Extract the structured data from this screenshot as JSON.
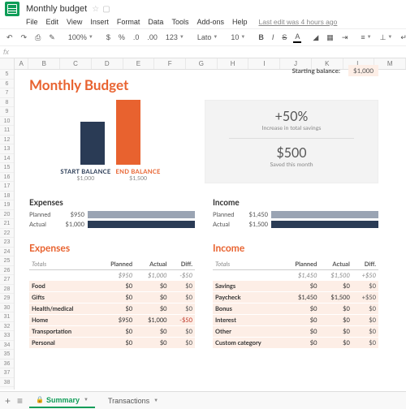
{
  "header": {
    "doc_title": "Monthly budget",
    "last_edit": "Last edit was 4 hours ago"
  },
  "menu": {
    "items": [
      "File",
      "Edit",
      "View",
      "Insert",
      "Format",
      "Data",
      "Tools",
      "Add-ons",
      "Help"
    ]
  },
  "toolbar": {
    "zoom": "100%",
    "currency": "$",
    "percent": "%",
    "decimal": ".0",
    "decimal2": ".00",
    "num_format": "123",
    "font": "Lato",
    "font_size": "10",
    "bold": "B",
    "italic": "I",
    "strike": "S",
    "text_color": "A"
  },
  "doc": {
    "starting_balance_label": "Starting balance:",
    "starting_balance": "$1,000",
    "title": "Monthly Budget",
    "bars": {
      "start": {
        "label": "START BALANCE",
        "value": "$1,000"
      },
      "end": {
        "label": "END BALANCE",
        "value": "$1,500"
      }
    },
    "metrics": {
      "pct": "+50%",
      "pct_sub": "Increase in total savings",
      "saved": "$500",
      "saved_sub": "Saved this month"
    },
    "summary": {
      "expenses": {
        "title": "Expenses",
        "planned_lbl": "Planned",
        "planned": "$950",
        "actual_lbl": "Actual",
        "actual": "$1,000"
      },
      "income": {
        "title": "Income",
        "planned_lbl": "Planned",
        "planned": "$1,450",
        "actual_lbl": "Actual",
        "actual": "$1,500"
      }
    },
    "tables": {
      "expenses": {
        "title": "Expenses",
        "headers": [
          "Totals",
          "Planned",
          "Actual",
          "Diff."
        ],
        "totals": [
          "$950",
          "$1,000",
          "-$50"
        ],
        "rows": [
          {
            "name": "Food",
            "planned": "$0",
            "actual": "$0",
            "diff": "$0"
          },
          {
            "name": "Gifts",
            "planned": "$0",
            "actual": "$0",
            "diff": "$0"
          },
          {
            "name": "Health/medical",
            "planned": "$0",
            "actual": "$0",
            "diff": "$0"
          },
          {
            "name": "Home",
            "planned": "$950",
            "actual": "$1,000",
            "diff": "-$50",
            "neg": true
          },
          {
            "name": "Transportation",
            "planned": "$0",
            "actual": "$0",
            "diff": "$0"
          },
          {
            "name": "Personal",
            "planned": "$0",
            "actual": "$0",
            "diff": "$0"
          }
        ]
      },
      "income": {
        "title": "Income",
        "headers": [
          "Totals",
          "Planned",
          "Actual",
          "Diff."
        ],
        "totals": [
          "$1,450",
          "$1,500",
          "+$50"
        ],
        "rows": [
          {
            "name": "Savings",
            "planned": "$0",
            "actual": "$0",
            "diff": "$0"
          },
          {
            "name": "Paycheck",
            "planned": "$1,450",
            "actual": "$1,500",
            "diff": "+$50"
          },
          {
            "name": "Bonus",
            "planned": "$0",
            "actual": "$0",
            "diff": "$0"
          },
          {
            "name": "Interest",
            "planned": "$0",
            "actual": "$0",
            "diff": "$0"
          },
          {
            "name": "Other",
            "planned": "$0",
            "actual": "$0",
            "diff": "$0"
          },
          {
            "name": "Custom category",
            "planned": "$0",
            "actual": "$0",
            "diff": "$0"
          }
        ]
      }
    }
  },
  "tabs": {
    "active": "Summary",
    "other": "Transactions"
  },
  "columns": [
    "A",
    "B",
    "C",
    "D",
    "E",
    "F",
    "G",
    "H",
    "I",
    "J",
    "K",
    "L",
    "M"
  ],
  "chart_data": {
    "type": "bar",
    "categories": [
      "START BALANCE",
      "END BALANCE"
    ],
    "values": [
      1000,
      1500
    ],
    "title": "Monthly Budget",
    "ylim": [
      0,
      1500
    ]
  }
}
